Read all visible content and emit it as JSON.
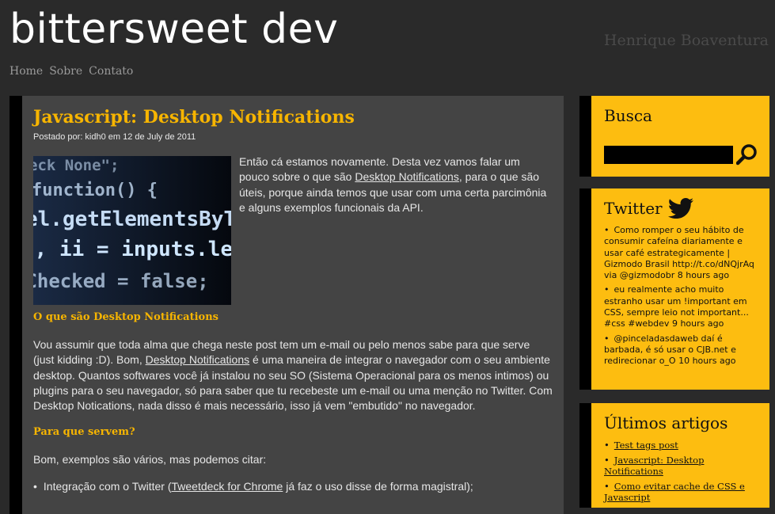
{
  "header": {
    "site_title": "bittersweet dev",
    "author": "Henrique Boaventura",
    "nav": [
      "Home",
      "Sobre",
      "Contato"
    ]
  },
  "post": {
    "title": "Javascript: Desktop Notifications",
    "meta": "Postado por: kidh0 em 12 de July de 2011",
    "code_lines": [
      "eck None\";",
      "function() {",
      "el.getElementsByTag",
      "), ii = inputs.leng",
      "nChecked = false;"
    ],
    "intro_before": "Então cá estamos novamente. Desta vez vamos falar um pouco sobre o que são ",
    "intro_link": "Desktop Notifications",
    "intro_after": ", para o que são úteis, porque ainda temos que usar com uma certa parcimônia e alguns exemplos funcionais da API.",
    "sub1": "O que são Desktop Notifications",
    "p2_before": "Vou assumir que toda alma que chega neste post tem um e-mail ou pelo menos sabe para que serve (just kidding :D). Bom, ",
    "p2_link": "Desktop Notifications",
    "p2_after": " é uma maneira de integrar o navegador com o seu ambiente desktop. Quantos softwares você já instalou no seu SO (Sistema Operacional para os menos intimos) ou plugins para o seu navegador, só para saber que tu recebeste um e-mail ou uma menção no Twitter. Com Desktop Notications, nada disso é mais necessário, isso já vem \"embutido\" no navegador.",
    "sub2": "Para que servem?",
    "p3": "Bom, exemplos são vários, mas podemos citar:",
    "li1_before": "Integração com o Twitter (",
    "li1_link": "Tweetdeck for Chrome",
    "li1_after": " já faz o uso disse de forma magistral);"
  },
  "sidebar": {
    "busca": {
      "title": "Busca",
      "search_icon": "magnifier-icon"
    },
    "twitter": {
      "title": "Twitter",
      "icon": "twitter-bird-icon",
      "tweets": [
        "Como romper o seu hábito de consumir cafeína diariamente e usar café estrategicamente | Gizmodo Brasil http://t.co/dNQjrAq via @gizmodobr 8 hours ago",
        "eu realmente acho muito estranho usar um !important em CSS, sempre leio not important... #css #webdev 9 hours ago",
        "@pinceladasdaweb daí é barbada, é só usar o CJB.net e redirecionar o_O 10 hours ago"
      ]
    },
    "artigos": {
      "title": "Últimos artigos",
      "items": [
        "Test tags post",
        "Javascript: Desktop Notifications",
        "Como evitar cache de CSS e Javascript"
      ]
    }
  },
  "colors": {
    "accent": "#f7b500",
    "widget_bg": "#fdbd10",
    "post_bg": "#444444",
    "page_bg": "#2a2a2a"
  }
}
